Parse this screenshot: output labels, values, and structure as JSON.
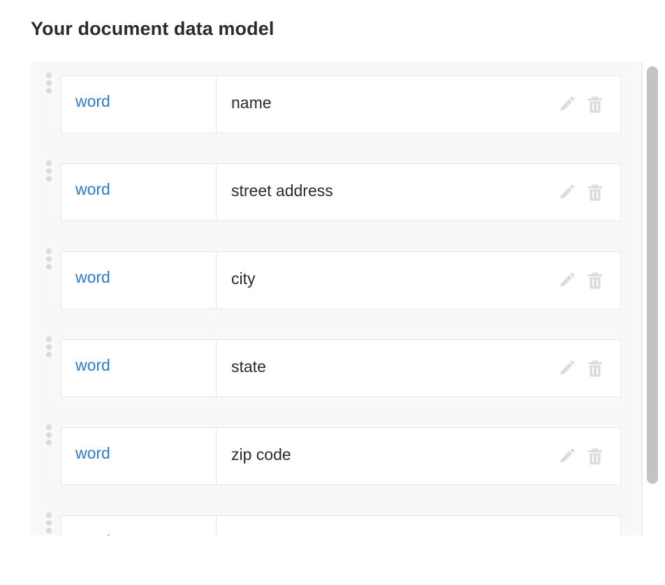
{
  "header": {
    "title": "Your document data model"
  },
  "fields": [
    {
      "type": "word",
      "name": "name"
    },
    {
      "type": "word",
      "name": "street address"
    },
    {
      "type": "word",
      "name": "city"
    },
    {
      "type": "word",
      "name": "state"
    },
    {
      "type": "word",
      "name": "zip code"
    },
    {
      "type": "word",
      "name": ""
    }
  ],
  "icons": {
    "drag": "drag-handle-icon",
    "edit": "pencil-icon",
    "delete": "trash-icon"
  },
  "colors": {
    "type_link": "#2b7bd6",
    "text": "#2b2b2b",
    "panel_background": "#f7f8f8",
    "icon_disabled": "#dcdcdc",
    "scrollbar_thumb": "#c3c3c3"
  }
}
